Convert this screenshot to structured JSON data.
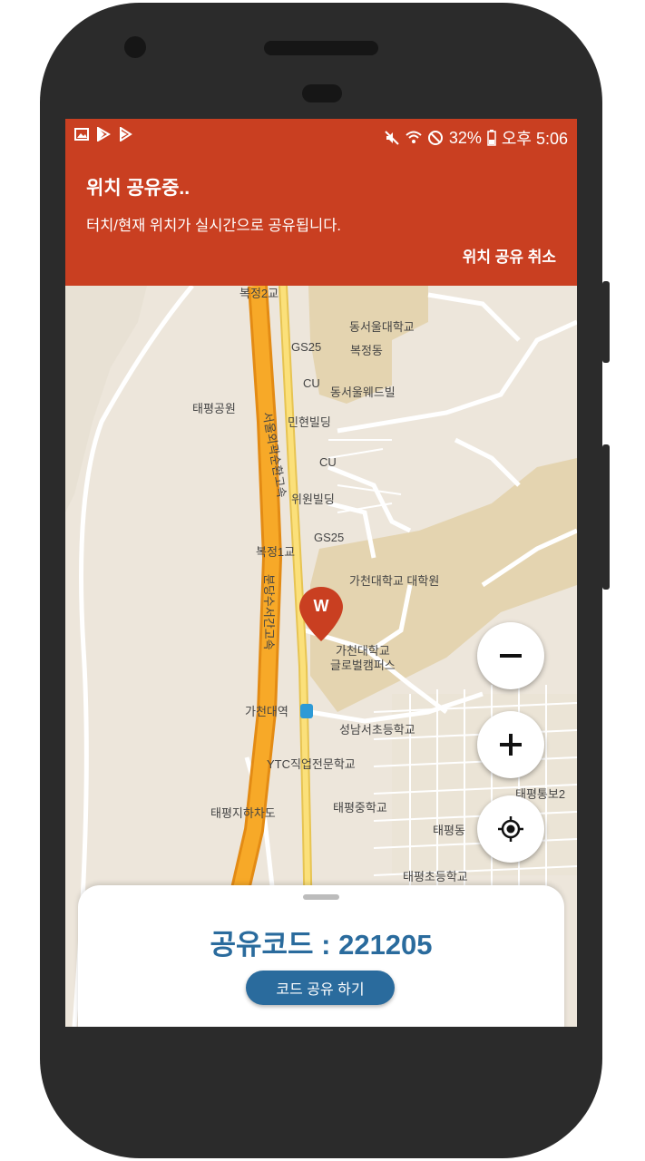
{
  "status_bar": {
    "battery": "32%",
    "time": "오후 5:06",
    "left_icons": [
      "image-icon",
      "play-store-icon",
      "play-icon"
    ],
    "right_icons": [
      "mute-icon",
      "wifi-icon",
      "block-icon",
      "battery-icon"
    ]
  },
  "notification": {
    "title": "위치 공유중..",
    "message": "터치/현재 위치가 실시간으로 공유됩니다.",
    "cancel_label": "위치 공유 취소"
  },
  "map": {
    "labels": {
      "bokjeong2": "복정2교",
      "dongseoul_univ": "동서울대학교",
      "gs25_1": "GS25",
      "bokjeongdong": "복정동",
      "cu_1": "CU",
      "dongseoul_building": "동서울웨드빌",
      "taepyeong_park": "태평공원",
      "minhyeon": "민현빌딩",
      "cu_2": "CU",
      "wiwon": "위원빌딩",
      "gs25_2": "GS25",
      "bokjeong1": "복정1교",
      "gachon_grad": "가천대학교 대학원",
      "gachon_global_1": "가천대학교",
      "gachon_global_2": "글로벌캠퍼스",
      "gachon_station": "가천대역",
      "seongnam_elem": "성남서초등학교",
      "ytc": "YTC직업전문학교",
      "taepyeong_underpass": "태평지하차도",
      "taepyeong_middle": "태평중학교",
      "taepyeongdong": "태평동",
      "taepyeong_elem": "태평초등학교",
      "taepyeongro": "태평통보2",
      "highway_1": "서울외곽순환고속",
      "highway_2": "분당수서간고속"
    },
    "marker_letter": "W"
  },
  "controls": {
    "zoom_out_icon": "minus-icon",
    "zoom_in_icon": "plus-icon",
    "locate_icon": "my-location-icon"
  },
  "sheet": {
    "share_code_text": "공유코드 : 221205",
    "share_button_label": "코드 공유 하기"
  },
  "colors": {
    "accent": "#c93f21",
    "primary": "#2a6b9d",
    "highway": "#f39b1c",
    "road": "#ffffff",
    "campus": "#e4d4b0",
    "park": "#cfe5c5"
  }
}
